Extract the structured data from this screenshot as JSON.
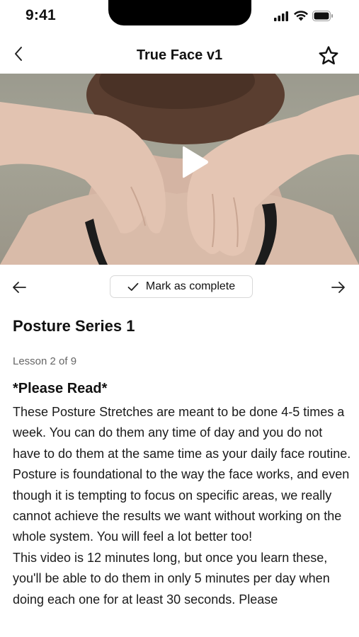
{
  "status_bar": {
    "time": "9:41",
    "icons": [
      "signal-icon",
      "wifi-icon",
      "battery-icon"
    ]
  },
  "nav": {
    "back_icon": "chevron-left-icon",
    "title": "True Face v1",
    "favorite_icon": "star-outline-icon"
  },
  "video": {
    "play_icon": "play-icon"
  },
  "controls": {
    "prev_icon": "arrow-left-icon",
    "next_icon": "arrow-right-icon",
    "mark_complete_label": "Mark as complete",
    "check_icon": "check-icon"
  },
  "lesson": {
    "series_title": "Posture Series 1",
    "progress": "Lesson 2 of 9",
    "heading": "*Please Read*",
    "paragraphs": [
      "These Posture Stretches are meant to be done 4-5 times a week. You can do them any time of day and you do not have to do them at the same time as your daily face routine.",
      "Posture is foundational to the way the face works, and even though it is tempting to focus on specific areas, we really cannot achieve the results we want without working on the whole system. You will feel a lot better too!",
      "This video is 12 minutes long, but once you learn these, you'll be able to do them in only 5 minutes per day when doing each one for at least 30 seconds. Please"
    ]
  },
  "colors": {
    "text": "#111111",
    "muted": "#666666",
    "border": "#d8d8d8",
    "video_bg": "#a09f92"
  }
}
